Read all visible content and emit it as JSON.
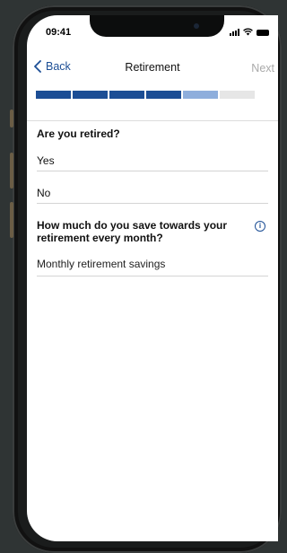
{
  "status_bar": {
    "time": "09:41"
  },
  "nav": {
    "back_label": "Back",
    "title": "Retirement",
    "next_label": "Next"
  },
  "progress": {
    "segments_total": 6,
    "segments_done": 4,
    "segments_current": 1
  },
  "form": {
    "q1": {
      "label": "Are you retired?",
      "options": [
        "Yes",
        "No"
      ]
    },
    "q2": {
      "label": "How much do you save towards your retirement every month?",
      "input_placeholder": "Monthly retirement savings"
    }
  },
  "colors": {
    "accent": "#1c4e95",
    "accent_light": "#8eaedc",
    "disabled_text": "#aaaaaa",
    "background": "#2f3434"
  },
  "icons": {
    "back": "chevron-left-icon",
    "info": "info-icon",
    "signal": "cellular-signal-icon",
    "wifi": "wifi-icon",
    "battery": "battery-icon"
  }
}
